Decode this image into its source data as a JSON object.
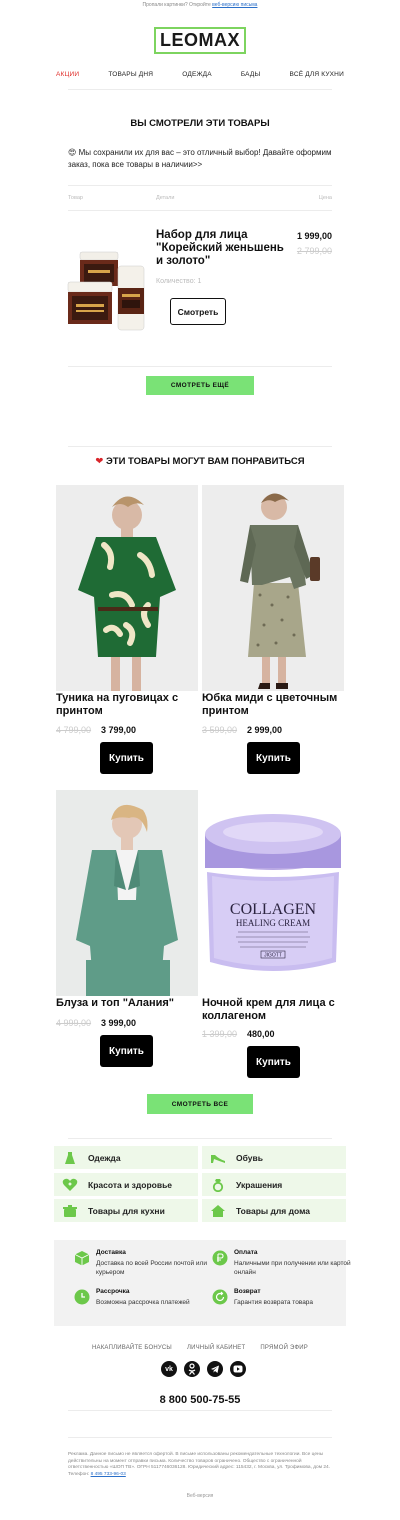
{
  "preheader": {
    "text": "Пропали картинки? Откройте",
    "link": "веб-версию письма"
  },
  "logo": "LEOMAX",
  "menu": [
    "АКЦИИ",
    "ТОВАРЫ ДНЯ",
    "ОДЕЖДА",
    "БАДЫ",
    "ВСЁ ДЛЯ КУХНИ"
  ],
  "viewed": {
    "title": "ВЫ СМОТРЕЛИ ЭТИ ТОВАРЫ",
    "lead": "😍 Мы сохранили их для вас – это отличный выбор! Давайте оформим заказ, пока все товары в наличии>>",
    "columns": [
      "Товар",
      "Детали",
      "Цена"
    ],
    "product": {
      "name": "Набор для лица \"Корейский женьшень и золото\"",
      "price": "1 999,00",
      "old_price": "2 799,00",
      "quantity": "Количество: 1",
      "button": "Смотреть"
    },
    "more_button": "СМОТРЕТЬ ЕЩЁ"
  },
  "recommend": {
    "title": "ЭТИ ТОВАРЫ МОГУТ ВАМ ПОНРАВИТЬСЯ",
    "items": [
      {
        "title": "Туника на пуговицах с принтом",
        "old": "4 799,00",
        "price": "3 799,00",
        "button": "Купить"
      },
      {
        "title": "Юбка миди с цветочным принтом",
        "old": "3 599,00",
        "price": "2 999,00",
        "button": "Купить"
      },
      {
        "title": "Блуза и топ \"Алания\"",
        "old": "4 999,00",
        "price": "3 999,00",
        "button": "Купить"
      },
      {
        "title": "Ночной крем для лица с коллагеном",
        "old": "1 399,00",
        "price": "480,00",
        "button": "Купить"
      }
    ],
    "all_button": "СМОТРЕТЬ ВСЕ",
    "jar_text": {
      "line1": "COLLAGEN",
      "line2": "HEALING CREAM",
      "brand": "JIGOTT"
    }
  },
  "categories": [
    "Одежда",
    "Обувь",
    "Красота и здоровье",
    "Украшения",
    "Товары для кухни",
    "Товары для дома"
  ],
  "info": [
    {
      "title": "Доставка",
      "text": "Доставка по всей России почтой или курьером"
    },
    {
      "title": "Оплата",
      "text": "Наличными при получении или картой онлайн"
    },
    {
      "title": "Рассрочка",
      "text": "Возможна рассрочка платежей"
    },
    {
      "title": "Возврат",
      "text": "Гарантия возврата товара"
    }
  ],
  "footer_links": [
    "НАКАПЛИВАЙТЕ БОНУСЫ",
    "ЛИЧНЫЙ КАБИНЕТ",
    "ПРЯМОЙ ЭФИР"
  ],
  "social": [
    "vk",
    "ok",
    "telegram",
    "youtube"
  ],
  "phone": "8 800 500-75-55",
  "legal": "Реклама. Данное письмо не является офертой. В письме использованы рекомендательные технологии. Все цены действительны на момент отправки письма. Количество товаров ограничено. Общество с ограниченной ответственностью «ШОП ТВ». ОГРН 5117746036128. Юридический адрес: 115432, г. Москва, ул. Трофимова, дом 24. Телефон:",
  "legal_phone": "8 495 733-96-03",
  "web_version": "Веб-версия",
  "colors": {
    "accent_green": "#7ae276",
    "logo_border": "#7dd45f",
    "menu_active": "#e0302c",
    "category_bg": "#eef8e9"
  }
}
